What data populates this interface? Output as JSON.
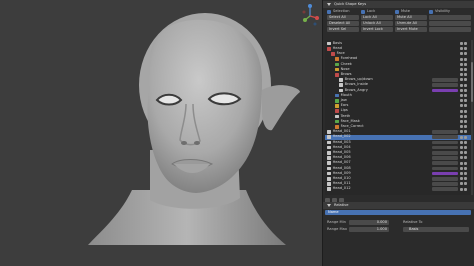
{
  "panel": {
    "title": "Quick Shape Keys",
    "groups": [
      {
        "label": "Selection",
        "buttons": [
          "Select All",
          "Deselect All",
          "Invert Sel"
        ]
      },
      {
        "label": "Lock",
        "buttons": [
          "Lock All",
          "Unlock All",
          "Invert Lock"
        ]
      },
      {
        "label": "Mute",
        "buttons": [
          "Mute All",
          "Unmute All",
          "Invert Mute"
        ]
      },
      {
        "label": "Visibility",
        "buttons": [
          "",
          "",
          ""
        ]
      }
    ]
  },
  "shape_keys": [
    {
      "label": "Basis",
      "color": "#c8c8c8",
      "indent": 0,
      "bar": null,
      "selected": false
    },
    {
      "label": "Head",
      "color": "#c04b4b",
      "indent": 0,
      "bar": null,
      "selected": false
    },
    {
      "label": "Face",
      "color": "#c04b4b",
      "indent": 1,
      "bar": null,
      "selected": false
    },
    {
      "label": "Forehead",
      "color": "#d07a30",
      "indent": 2,
      "bar": null,
      "selected": false
    },
    {
      "label": "Cheek",
      "color": "#5aa84a",
      "indent": 2,
      "bar": null,
      "selected": false
    },
    {
      "label": "Nose",
      "color": "#d0a030",
      "indent": 2,
      "bar": null,
      "selected": false
    },
    {
      "label": "Brows",
      "color": "#c04b4b",
      "indent": 2,
      "bar": null,
      "selected": false
    },
    {
      "label": "Brows_up/down",
      "color": "#c8c8c8",
      "indent": 3,
      "bar": "#4a4a4a",
      "selected": false
    },
    {
      "label": "Brows_Inside",
      "color": "#c8c8c8",
      "indent": 3,
      "bar": "#4a4a4a",
      "selected": false
    },
    {
      "label": "Brows_Angry",
      "color": "#c8c8c8",
      "indent": 3,
      "bar": "#7a3fb0",
      "selected": false
    },
    {
      "label": "Mouth",
      "color": "#4772b3",
      "indent": 2,
      "bar": null,
      "selected": false
    },
    {
      "label": "Jaw",
      "color": "#5aa84a",
      "indent": 2,
      "bar": null,
      "selected": false
    },
    {
      "label": "Ears",
      "color": "#d0a030",
      "indent": 2,
      "bar": null,
      "selected": false
    },
    {
      "label": "Lips",
      "color": "#c04b4b",
      "indent": 2,
      "bar": null,
      "selected": false
    },
    {
      "label": "Teeth",
      "color": "#c8c8c8",
      "indent": 2,
      "bar": null,
      "selected": false
    },
    {
      "label": "Face_Mask",
      "color": "#5aa84a",
      "indent": 2,
      "bar": null,
      "selected": false
    },
    {
      "label": "Face_Correct",
      "color": "#d07a30",
      "indent": 2,
      "bar": null,
      "selected": false
    },
    {
      "label": "Head_001",
      "color": "#c8c8c8",
      "indent": 0,
      "bar": "#4a4a4a",
      "selected": false
    },
    {
      "label": "Head_002",
      "color": "#c8c8c8",
      "indent": 0,
      "bar": "#4a4a4a",
      "selected": true
    },
    {
      "label": "Head_003",
      "color": "#c8c8c8",
      "indent": 0,
      "bar": "#4a4a4a",
      "selected": false
    },
    {
      "label": "Head_004",
      "color": "#c8c8c8",
      "indent": 0,
      "bar": "#4a4a4a",
      "selected": false
    },
    {
      "label": "Head_005",
      "color": "#c8c8c8",
      "indent": 0,
      "bar": "#4a4a4a",
      "selected": false
    },
    {
      "label": "Head_006",
      "color": "#c8c8c8",
      "indent": 0,
      "bar": "#4a4a4a",
      "selected": false
    },
    {
      "label": "Head_007",
      "color": "#c8c8c8",
      "indent": 0,
      "bar": "#4a4a4a",
      "selected": false
    },
    {
      "label": "Head_008",
      "color": "#c8c8c8",
      "indent": 0,
      "bar": "#4a4a4a",
      "selected": false
    },
    {
      "label": "Head_009",
      "color": "#c8c8c8",
      "indent": 0,
      "bar": "#7a3fb0",
      "selected": false
    },
    {
      "label": "Head_010",
      "color": "#c8c8c8",
      "indent": 0,
      "bar": "#4a4a4a",
      "selected": false
    },
    {
      "label": "Head_011",
      "color": "#c8c8c8",
      "indent": 0,
      "bar": "#4a4a4a",
      "selected": false
    },
    {
      "label": "Head_012",
      "color": "#c8c8c8",
      "indent": 0,
      "bar": "#4a4a4a",
      "selected": false
    }
  ],
  "bottom": {
    "section_title": "Relative",
    "search_label": "Name",
    "range_min_label": "Range Min",
    "range_min_value": "0.000",
    "range_max_label": "Range Max",
    "range_max_value": "1.000",
    "relative_to_label": "Relative To",
    "basis_value": "Basis"
  },
  "colors": {
    "accent": "#4772b3",
    "viewport_bg": "#3d3d3d",
    "panel_bg": "#2b2b2b"
  },
  "icons": [
    "gizmo-axes-icon",
    "shape-key-icon",
    "lock-icon",
    "visibility-icon"
  ]
}
